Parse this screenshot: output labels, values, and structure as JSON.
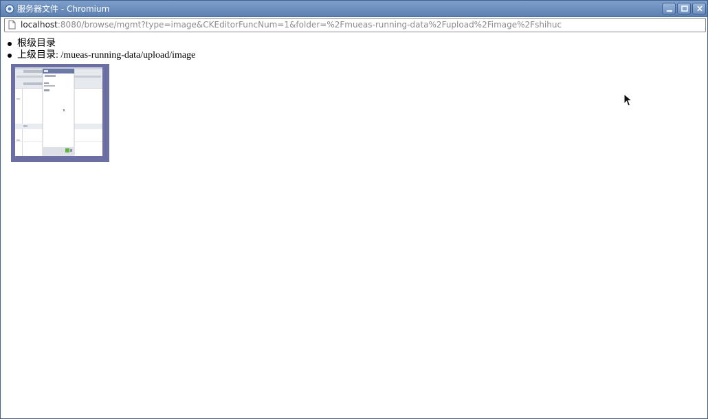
{
  "window": {
    "title": "服务器文件 - Chromium"
  },
  "address": {
    "host": "localhost",
    "rest": ":8080/browse/mgmt?type=image&CKEditorFuncNum=1&folder=%2Fmueas-running-data%2Fupload%2Fimage%2Fshihuc"
  },
  "nav": {
    "root_label": "根级目录",
    "parent_label": "上级目录",
    "parent_path": ": /mueas-running-data/upload/image"
  },
  "icons": {
    "window": "chromium-icon",
    "page": "page-icon",
    "minimize": "minimize-icon",
    "maximize": "maximize-icon",
    "close": "close-icon"
  },
  "colors": {
    "titlebar": "#5b7fb0",
    "thumb_border": "#6b6fa3"
  }
}
